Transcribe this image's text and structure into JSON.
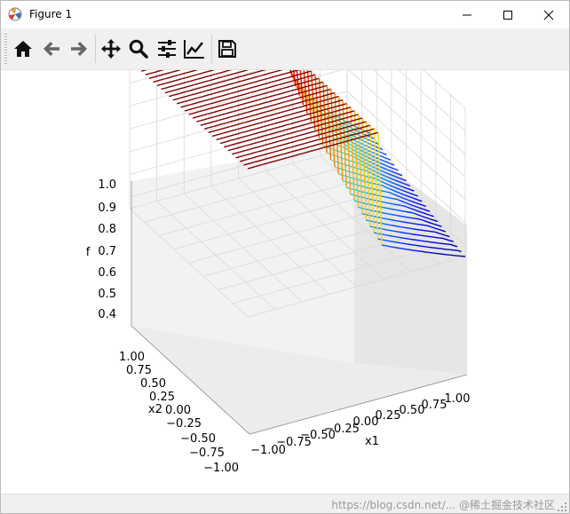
{
  "window": {
    "title": "Figure 1"
  },
  "toolbar": {
    "tools": [
      "home-icon",
      "back-arrow-icon",
      "forward-arrow-icon",
      "pan-icon",
      "zoom-icon",
      "subplots-config-icon",
      "edit-axes-icon",
      "save-icon"
    ]
  },
  "colors": {
    "accent_red": "#c80000",
    "surface_low": "#0000ff",
    "pane": "#f2f2f2"
  },
  "plot": {
    "type": "3d-wireframe-surface",
    "colormap": "jet",
    "zlabel": "f",
    "xlabel": "x1",
    "ylabel": "x2",
    "z_ticks": [
      "1.0",
      "0.9",
      "0.8",
      "0.7",
      "0.6",
      "0.5",
      "0.4"
    ],
    "x_ticks": [
      "−1.00",
      "−0.75",
      "−0.50",
      "−0.25",
      "0.00",
      "0.25",
      "0.50",
      "0.75",
      "1.00"
    ],
    "y_ticks": [
      "1.00",
      "0.75",
      "0.50",
      "0.25",
      "0.00",
      "−0.25",
      "−0.50",
      "−0.75",
      "−1.00"
    ],
    "x_range": [
      -1,
      1
    ],
    "y_range": [
      -1,
      1
    ],
    "z_range": [
      0.35,
      1.0
    ]
  },
  "status": {
    "watermark": "https://blog.csdn.net/... @稀土掘金技术社区"
  }
}
